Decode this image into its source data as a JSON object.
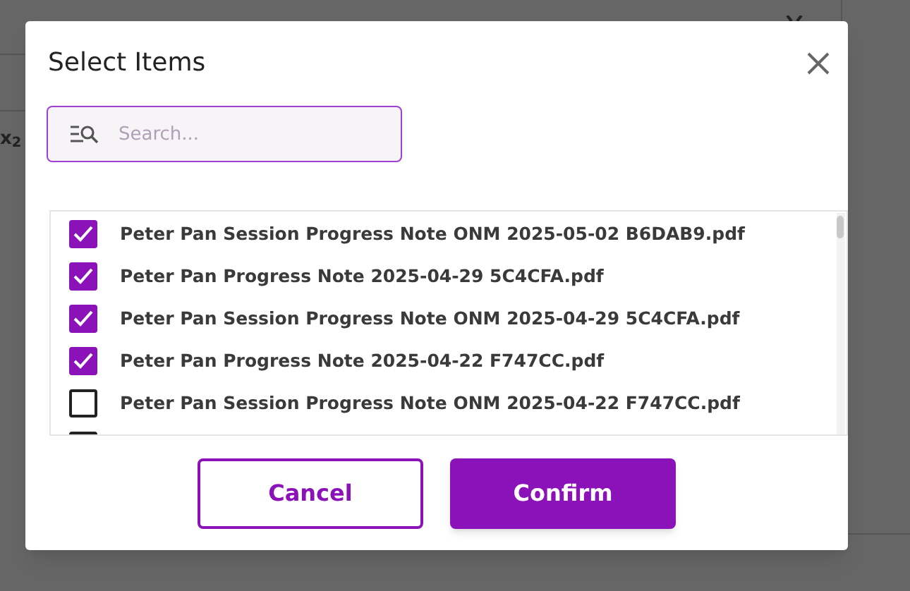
{
  "backdrop": {
    "text": "x$_{2}$"
  },
  "dialog": {
    "title": "Select Items",
    "search": {
      "placeholder": "Search..."
    },
    "items": [
      {
        "label": "Peter Pan Session Progress Note ONM 2025-05-02 B6DAB9.pdf",
        "checked": true
      },
      {
        "label": "Peter Pan Progress Note 2025-04-29 5C4CFA.pdf",
        "checked": true
      },
      {
        "label": "Peter Pan Session Progress Note ONM 2025-04-29 5C4CFA.pdf",
        "checked": true
      },
      {
        "label": "Peter Pan Progress Note 2025-04-22 F747CC.pdf",
        "checked": true
      },
      {
        "label": "Peter Pan Session Progress Note ONM 2025-04-22 F747CC.pdf",
        "checked": false
      },
      {
        "checked": false
      }
    ],
    "buttons": [
      {
        "label": "Cancel",
        "kind": "secondary"
      },
      {
        "label": "Confirm",
        "kind": "primary"
      }
    ]
  }
}
